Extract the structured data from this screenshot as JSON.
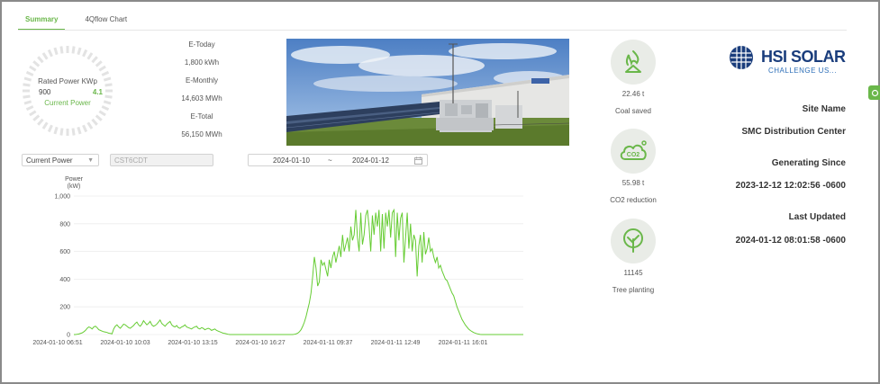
{
  "tabs": [
    {
      "label": "Summary",
      "active": true
    },
    {
      "label": "4Qflow Chart",
      "active": false
    }
  ],
  "gauge": {
    "rated_label": "Rated Power KWp",
    "rated_value": "900",
    "current_value": "4.1",
    "current_label": "Current Power"
  },
  "energy": {
    "today_label": "E-Today",
    "today_value": "1,800 kWh",
    "monthly_label": "E-Monthly",
    "monthly_value": "14,603 MWh",
    "total_label": "E-Total",
    "total_value": "56,150 MWh"
  },
  "controls": {
    "metric_select": "Current Power",
    "device_placeholder": "CST6CDT",
    "date_start": "2024-01-10",
    "date_sep": "~",
    "date_end": "2024-01-12"
  },
  "impact": {
    "coal_value": "22.46 t",
    "coal_label": "Coal saved",
    "co2_value": "55.98 t",
    "co2_label": "CO2 reduction",
    "co2_icon_text": "CO2",
    "tree_value": "11145",
    "tree_label": "Tree planting"
  },
  "brand": {
    "name": "HSI SOLAR",
    "tagline": "CHALLENGE US..."
  },
  "site": {
    "name_label": "Site Name",
    "name_value": "SMC Distribution Center",
    "since_label": "Generating Since",
    "since_value": "2023-12-12 12:02:56 -0600",
    "updated_label": "Last Updated",
    "updated_value": "2024-01-12 08:01:58 -0600"
  },
  "colors": {
    "accent": "#6ab74a",
    "line": "#66cc33",
    "brand_dark": "#1a3d7c",
    "brand_light": "#2d6fb8"
  },
  "chart_data": {
    "type": "line",
    "ylabel": "Power\n(kW)",
    "ylabel_lines": [
      "Power",
      "(kW)"
    ],
    "ylim": [
      0,
      1000
    ],
    "yticks": [
      "0",
      "200",
      "400",
      "600",
      "800",
      "1,000"
    ],
    "x_tick_labels": [
      "2024-01-10 06:51",
      "2024-01-10 10:03",
      "2024-01-10 13:15",
      "2024-01-10 16:27",
      "2024-01-11 09:37",
      "2024-01-11 12:49",
      "2024-01-11 16:01"
    ],
    "grid": true,
    "series": [
      {
        "color": "#66cc33",
        "values": [
          0,
          0,
          2,
          4,
          8,
          12,
          20,
          30,
          45,
          55,
          50,
          40,
          55,
          60,
          50,
          35,
          30,
          25,
          20,
          18,
          15,
          10,
          8,
          5,
          40,
          60,
          70,
          55,
          45,
          60,
          75,
          70,
          60,
          50,
          45,
          55,
          65,
          80,
          90,
          70,
          60,
          75,
          100,
          85,
          70,
          80,
          95,
          70,
          60,
          65,
          75,
          90,
          105,
          80,
          70,
          60,
          75,
          85,
          95,
          70,
          60,
          55,
          65,
          50,
          45,
          55,
          60,
          70,
          55,
          50,
          45,
          40,
          50,
          55,
          60,
          45,
          40,
          50,
          45,
          35,
          40,
          45,
          40,
          30,
          35,
          40,
          30,
          25,
          20,
          15,
          10,
          8,
          5,
          2,
          0,
          0,
          0,
          0,
          0,
          0,
          0,
          0,
          0,
          0,
          0,
          0,
          0,
          0,
          0,
          0,
          0,
          0,
          0,
          0,
          0,
          0,
          0,
          0,
          0,
          0,
          0,
          0,
          0,
          0,
          0,
          0,
          0,
          0,
          0,
          0,
          0,
          0,
          0,
          2,
          5,
          10,
          20,
          35,
          60,
          90,
          130,
          180,
          230,
          300,
          420,
          560,
          480,
          350,
          380,
          540,
          500,
          520,
          470,
          420,
          540,
          480,
          560,
          600,
          520,
          580,
          640,
          560,
          720,
          600,
          650,
          700,
          600,
          780,
          680,
          720,
          900,
          700,
          600,
          880,
          650,
          720,
          860,
          900,
          780,
          600,
          860,
          720,
          880,
          780,
          900,
          600,
          870,
          620,
          880,
          780,
          900,
          700,
          880,
          900,
          560,
          880,
          680,
          840,
          880,
          520,
          700,
          880,
          620,
          800,
          600,
          720,
          680,
          420,
          640,
          720,
          520,
          740,
          580,
          620,
          700,
          600,
          620,
          560,
          520,
          560,
          480,
          500,
          460,
          430,
          400,
          390,
          360,
          330,
          300,
          280,
          240,
          200,
          170,
          140,
          110,
          90,
          70,
          55,
          40,
          30,
          22,
          15,
          10,
          6,
          3,
          1,
          0,
          0,
          0,
          0,
          0,
          0,
          0,
          0,
          0,
          0,
          0,
          0,
          0,
          0,
          0,
          0,
          0,
          0,
          0,
          0,
          0,
          0,
          0,
          0,
          0,
          0
        ]
      }
    ]
  }
}
